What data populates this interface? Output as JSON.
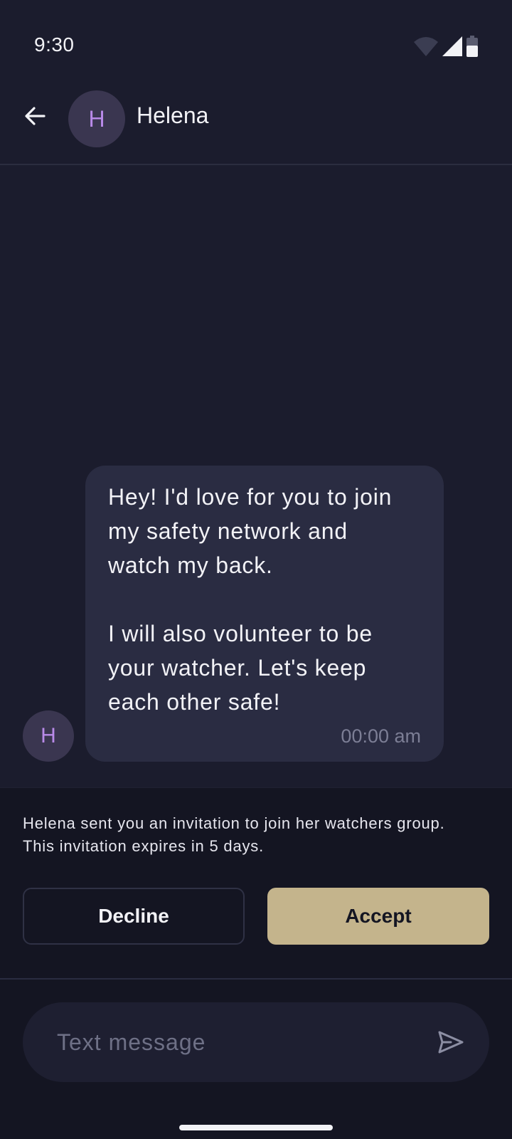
{
  "status_bar": {
    "time": "9:30",
    "icons": [
      "wifi-icon",
      "cell-signal-icon",
      "battery-icon"
    ]
  },
  "header": {
    "back_icon": "arrow-left-icon",
    "avatar_initial": "H",
    "contact_name": "Helena"
  },
  "message": {
    "avatar_initial": "H",
    "text": "Hey! I'd love for you to join\nmy safety network and\nwatch my back.\n\nI will also volunteer to be\nyour watcher. Let's keep\neach other safe!",
    "time": "00:00 am"
  },
  "invitation": {
    "text_line1": "Helena sent you an invitation to join her watchers group.",
    "text_line2": "This invitation expires in 5 days.",
    "decline_label": "Decline",
    "accept_label": "Accept"
  },
  "composer": {
    "placeholder": "Text message",
    "value": "",
    "send_icon": "send-icon"
  },
  "colors": {
    "background": "#1b1c2d",
    "bubble": "#2a2c42",
    "avatar_bg": "#3a3650",
    "avatar_letter": "#b88ae8",
    "accept": "#c4b48c",
    "panel": "#141522"
  }
}
